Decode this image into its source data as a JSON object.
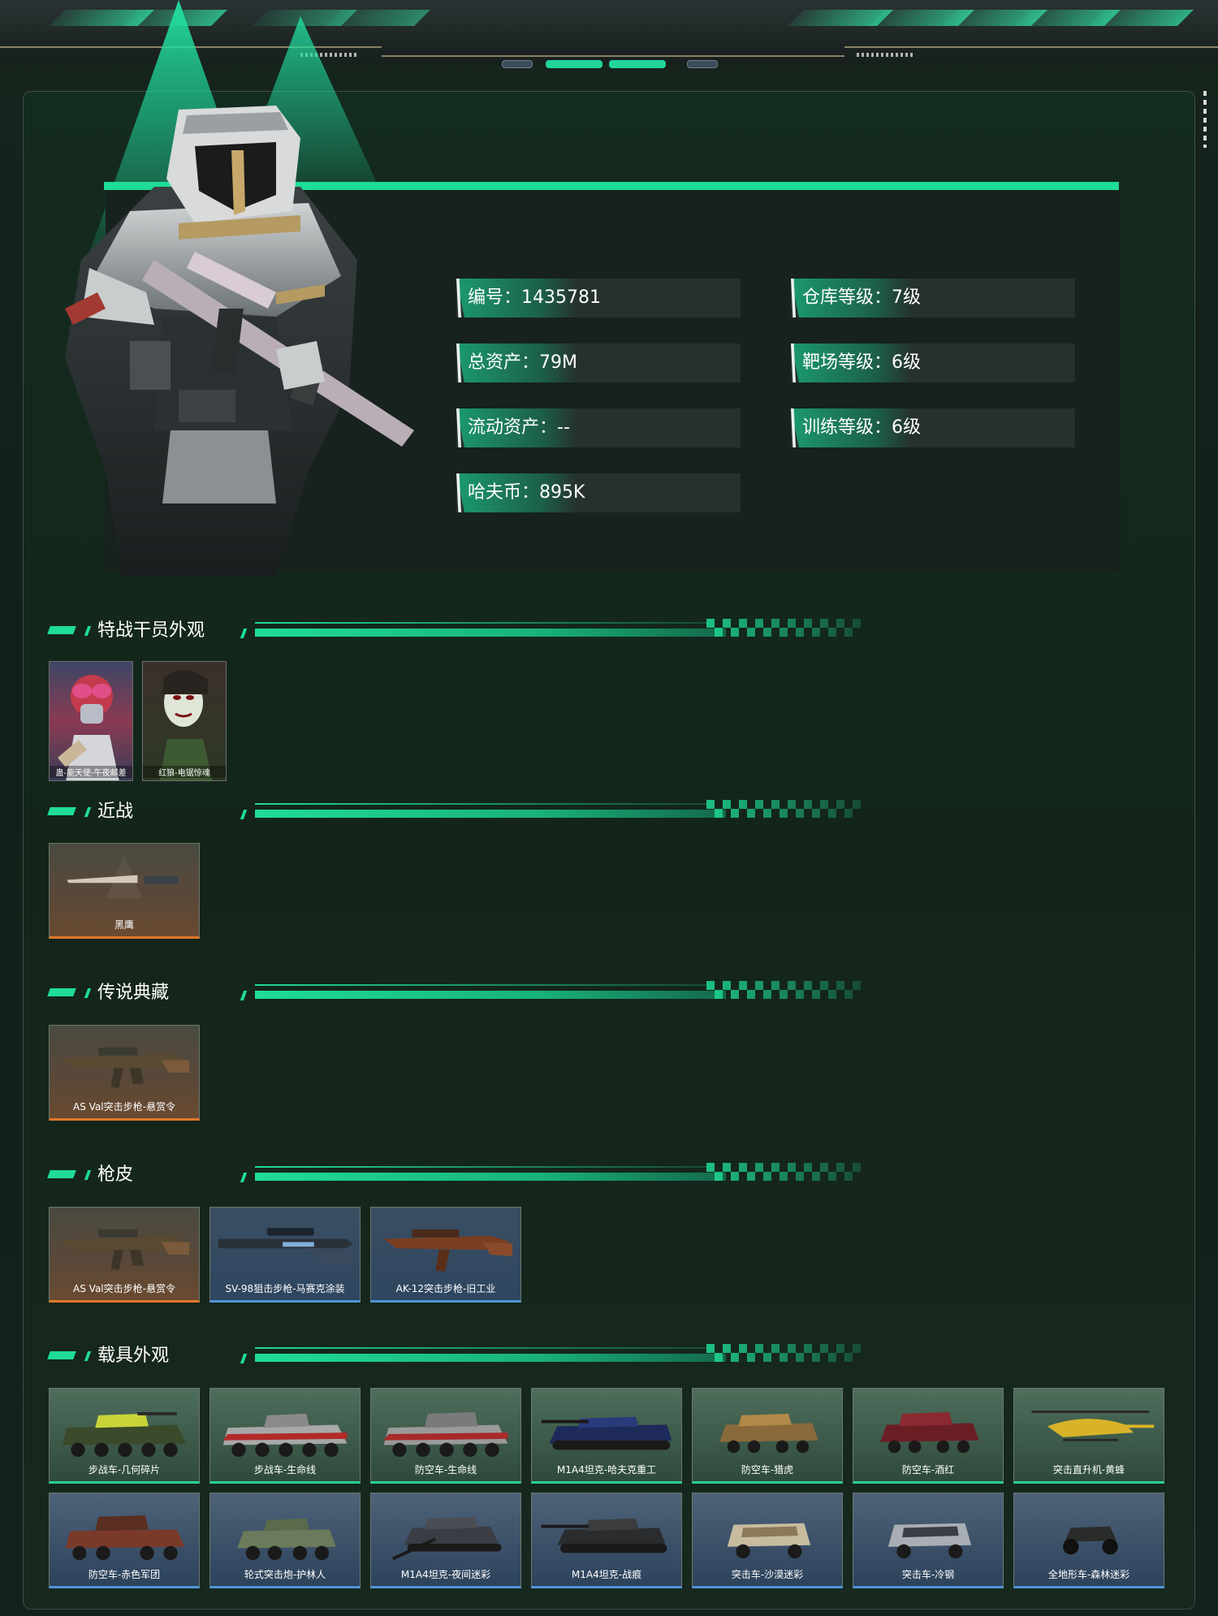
{
  "profile": {
    "stats_left": [
      {
        "label": "编号：1435781"
      },
      {
        "label": "总资产：79M"
      },
      {
        "label": "流动资产：--"
      },
      {
        "label": "哈夫币：895K"
      }
    ],
    "stats_right": [
      {
        "label": "仓库等级：7级"
      },
      {
        "label": "靶场等级：6级"
      },
      {
        "label": "训练等级：6级"
      }
    ]
  },
  "sections": {
    "agents": {
      "title": "特战干员外观",
      "items": [
        "蛊-能天使-午夜邮差",
        "红狼-电锯惊魂"
      ]
    },
    "melee": {
      "title": "近战",
      "items": [
        "黑鹰"
      ]
    },
    "legend": {
      "title": "传说典藏",
      "items": [
        "AS Val突击步枪-悬赏令"
      ]
    },
    "skins": {
      "title": "枪皮",
      "items": [
        "AS Val突击步枪-悬赏令",
        "SV-98狙击步枪-马赛克涂装",
        "AK-12突击步枪-旧工业"
      ]
    },
    "vehicles": {
      "title": "载具外观",
      "row1": [
        "步战车-几何碎片",
        "步战车-生命线",
        "防空车-生命线",
        "M1A4坦克-哈夫克重工",
        "防空车-猎虎",
        "防空车-酒红",
        "突击直升机-黄蜂"
      ],
      "row2": [
        "防空车-赤色军团",
        "轮式突击炮-护林人",
        "M1A4坦克-夜间迷彩",
        "M1A4坦克-战痕",
        "突击车-沙漠迷彩",
        "突击车-冷钢",
        "全地形车-森林迷彩"
      ]
    }
  },
  "colors": {
    "accent": "#1fdc98",
    "gold_rarity": "#e0782a",
    "blue_rarity": "#4f94d8"
  }
}
